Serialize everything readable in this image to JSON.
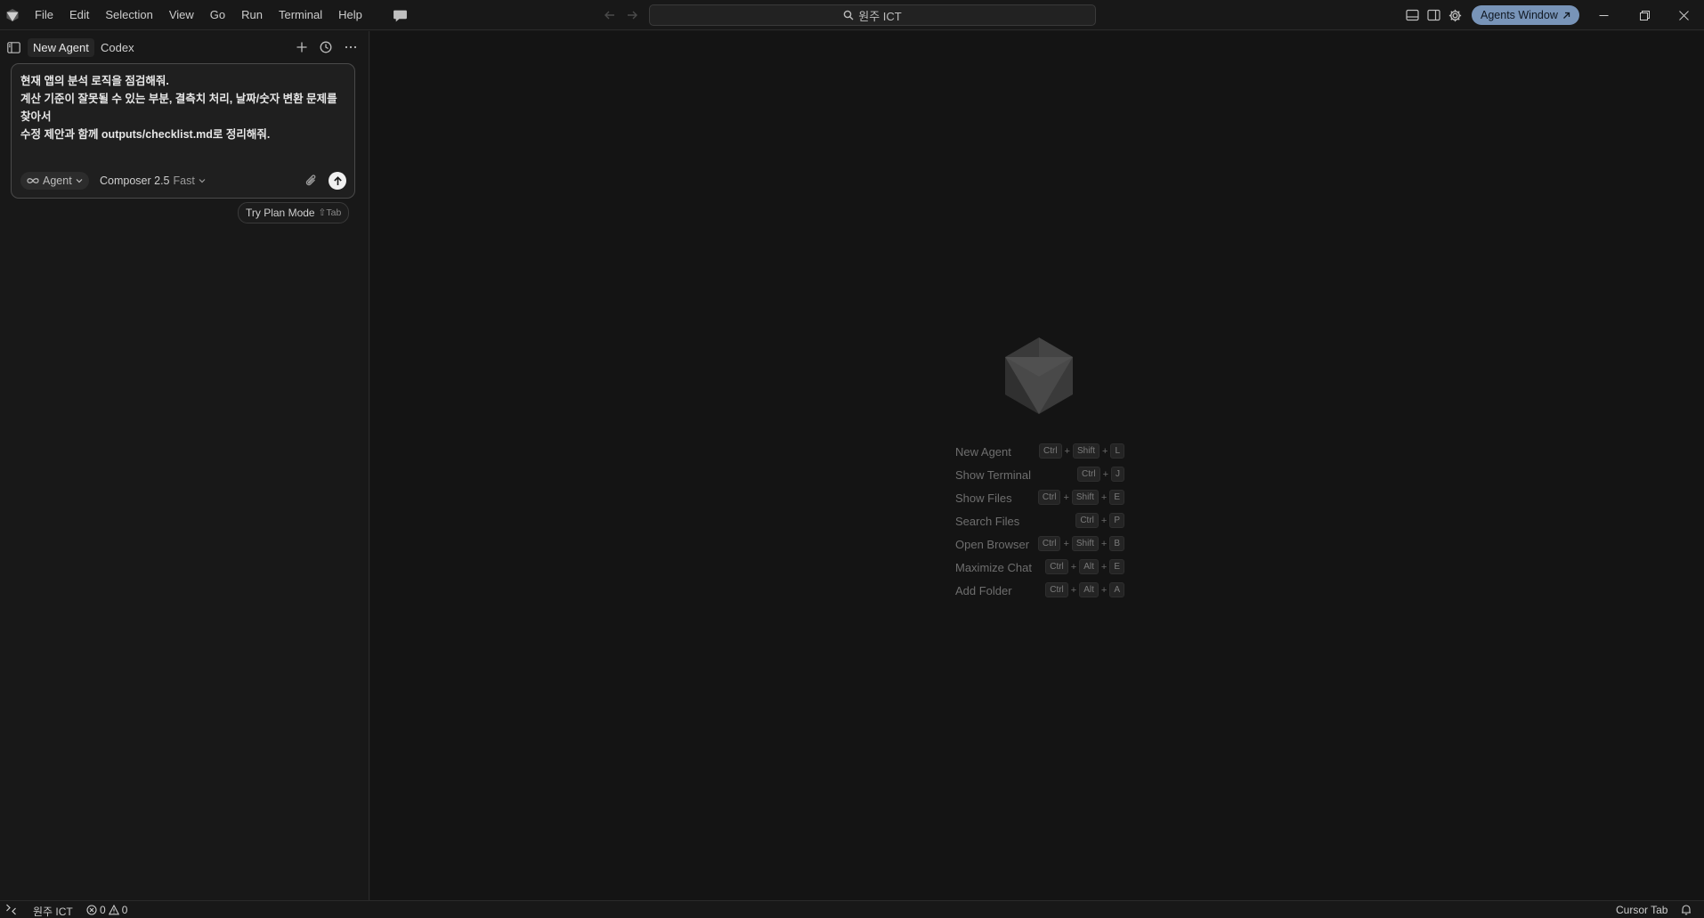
{
  "titlebar": {
    "menu": [
      "File",
      "Edit",
      "Selection",
      "View",
      "Go",
      "Run",
      "Terminal",
      "Help"
    ],
    "search_text": "원주 ICT",
    "agents_window_label": "Agents Window"
  },
  "sidebar": {
    "tabs": [
      "New Agent",
      "Codex"
    ],
    "composer": {
      "prompt_lines": [
        "현재 앱의 분석 로직을 점검해줘.",
        "계산 기준이 잘못될 수 있는 부분, 결측치 처리, 날짜/숫자 변환 문제를 찾아서",
        "수정 제안과 함께 outputs/checklist.md로 정리해줘."
      ],
      "mode_label": "Agent",
      "model_name": "Composer 2.5",
      "model_speed": "Fast"
    },
    "plan_hint": {
      "label": "Try Plan Mode",
      "shortcut": "⇧Tab"
    }
  },
  "main": {
    "shortcuts": [
      {
        "label": "New Agent",
        "keys": [
          "Ctrl",
          "Shift",
          "L"
        ]
      },
      {
        "label": "Show Terminal",
        "keys": [
          "Ctrl",
          "J"
        ]
      },
      {
        "label": "Show Files",
        "keys": [
          "Ctrl",
          "Shift",
          "E"
        ]
      },
      {
        "label": "Search Files",
        "keys": [
          "Ctrl",
          "P"
        ]
      },
      {
        "label": "Open Browser",
        "keys": [
          "Ctrl",
          "Shift",
          "B"
        ]
      },
      {
        "label": "Maximize Chat",
        "keys": [
          "Ctrl",
          "Alt",
          "E"
        ]
      },
      {
        "label": "Add Folder",
        "keys": [
          "Ctrl",
          "Alt",
          "A"
        ]
      }
    ]
  },
  "statusbar": {
    "workspace": "원주 ICT",
    "errors": "0",
    "warnings": "0",
    "cursor_tab": "Cursor Tab"
  },
  "colors": {
    "background": "#181818",
    "main_background": "#141414",
    "accent_button": "#7894b8",
    "border": "#2b2b2b"
  },
  "icons": [
    "cursor-logo-icon",
    "chat-icon",
    "back-arrow-icon",
    "forward-arrow-icon",
    "search-icon",
    "layout-panel-icon",
    "layout-sidebar-icon",
    "gear-icon",
    "external-arrow-icon",
    "minimize-icon",
    "restore-icon",
    "close-icon",
    "toggle-sidebar-icon",
    "plus-icon",
    "history-icon",
    "more-icon",
    "infinity-icon",
    "chevron-down-icon",
    "paperclip-icon",
    "arrow-up-icon",
    "cursor-cube-logo",
    "remote-icon",
    "error-icon",
    "warning-icon",
    "bell-icon"
  ]
}
